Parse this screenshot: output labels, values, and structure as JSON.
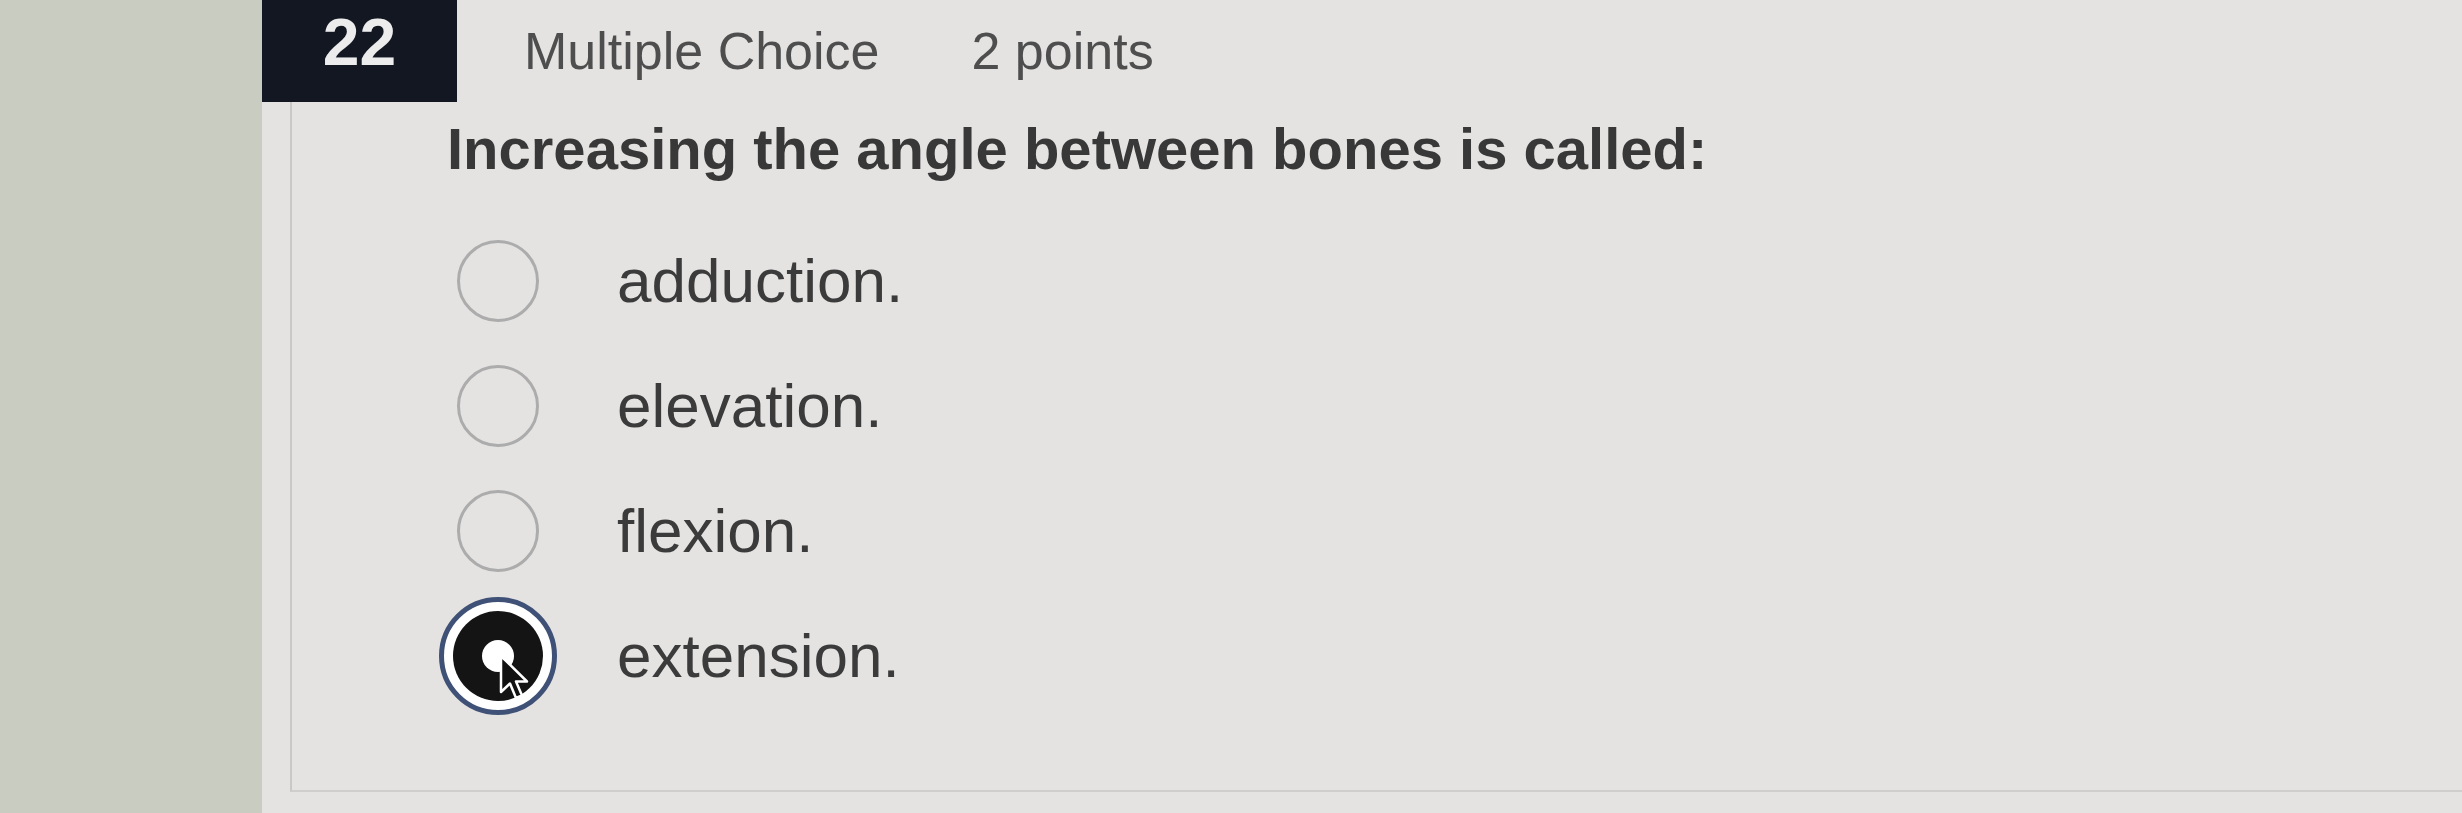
{
  "question": {
    "number": "22",
    "type": "Multiple Choice",
    "points": "2 points",
    "text": "Increasing the angle between bones is called:"
  },
  "options": [
    {
      "label": "adduction.",
      "selected": false
    },
    {
      "label": "elevation.",
      "selected": false
    },
    {
      "label": "flexion.",
      "selected": false
    },
    {
      "label": "extension.",
      "selected": true
    }
  ]
}
